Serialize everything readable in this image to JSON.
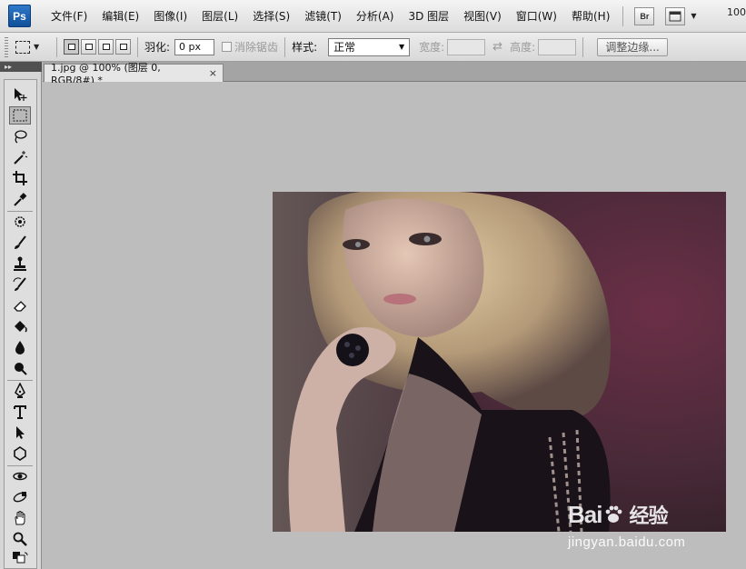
{
  "app": {
    "logo_label": "Ps"
  },
  "menu": [
    {
      "label": "文件(F)",
      "name": "menu-file"
    },
    {
      "label": "编辑(E)",
      "name": "menu-edit"
    },
    {
      "label": "图像(I)",
      "name": "menu-image"
    },
    {
      "label": "图层(L)",
      "name": "menu-layer"
    },
    {
      "label": "选择(S)",
      "name": "menu-select"
    },
    {
      "label": "滤镜(T)",
      "name": "menu-filter"
    },
    {
      "label": "分析(A)",
      "name": "menu-analysis"
    },
    {
      "label": "3D 图层",
      "name": "menu-3d"
    },
    {
      "label": "视图(V)",
      "name": "menu-view"
    },
    {
      "label": "窗口(W)",
      "name": "menu-window"
    },
    {
      "label": "帮助(H)",
      "name": "menu-help"
    }
  ],
  "menubar_extra": {
    "bridge_label": "Br",
    "zoom_label": "100"
  },
  "options": {
    "feather_label": "羽化:",
    "feather_value": "0 px",
    "antialias_label": "消除锯齿",
    "style_label": "样式:",
    "style_value": "正常",
    "width_label": "宽度:",
    "height_label": "高度:",
    "refine_edge_label": "调整边缘..."
  },
  "document": {
    "tab_title": "1.jpg @ 100% (图层 0, RGB/8#) *",
    "close_glyph": "×"
  },
  "toolbox": {
    "collapse_glyph": "▸▸",
    "tools": [
      "move-tool-icon",
      "rectangular-marquee-tool-icon",
      "lasso-tool-icon",
      "magic-wand-tool-icon",
      "crop-tool-icon",
      "eyedropper-tool-icon",
      "spot-healing-brush-tool-icon",
      "brush-tool-icon",
      "clone-stamp-tool-icon",
      "history-brush-tool-icon",
      "eraser-tool-icon",
      "paint-bucket-tool-icon",
      "blur-tool-icon",
      "dodge-tool-icon",
      "pen-tool-icon",
      "type-tool-icon",
      "path-selection-tool-icon",
      "shape-tool-icon",
      "3d-rotate-tool-icon",
      "3d-orbit-tool-icon",
      "hand-tool-icon",
      "zoom-tool-icon"
    ],
    "active_tool": "rectangular-marquee-tool-icon"
  },
  "watermark": {
    "brand": "Bai",
    "brand_suffix": "经验",
    "url": "jingyan.baidu.com"
  },
  "colors": {
    "canvas_bg": "#bdbdbd",
    "toolbox_bg": "#d6d6d6",
    "logo_blue": "#1f63b3"
  }
}
